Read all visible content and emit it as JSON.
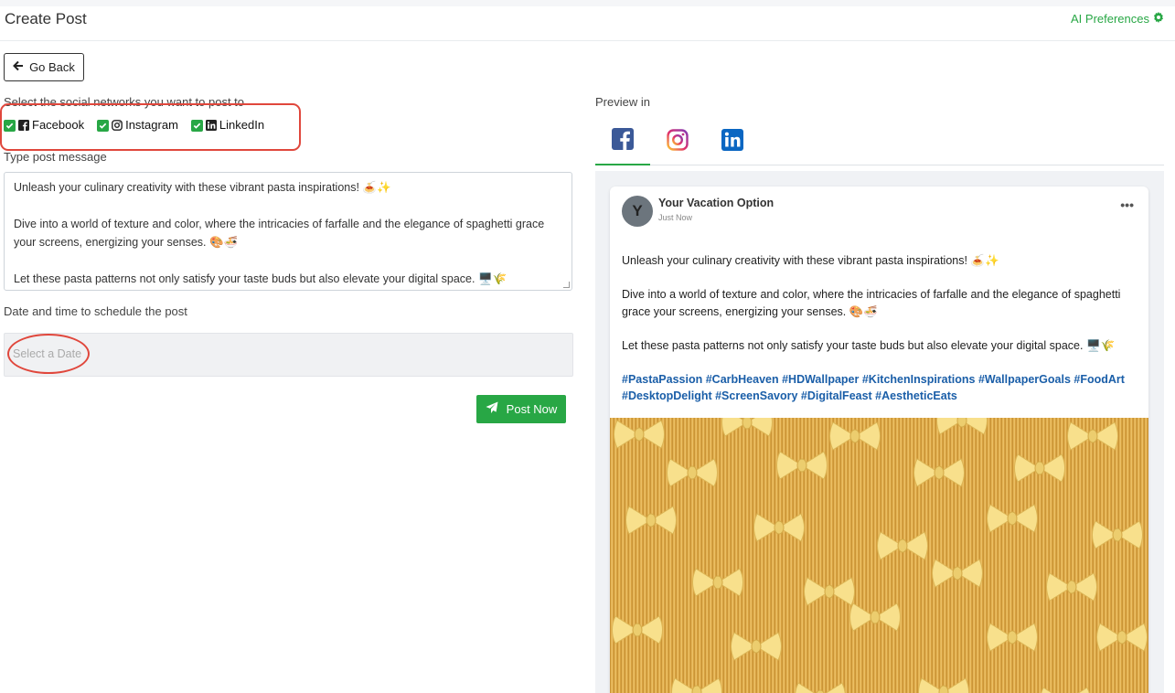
{
  "header": {
    "title": "Create Post",
    "ai_preferences": "AI Preferences"
  },
  "actions": {
    "go_back": "Go Back",
    "post_now": "Post Now"
  },
  "networks": {
    "label": "Select the social networks you want to post to",
    "items": [
      {
        "label": "Facebook",
        "checked": true,
        "icon": "facebook-square-icon"
      },
      {
        "label": "Instagram",
        "checked": true,
        "icon": "instagram-icon"
      },
      {
        "label": "LinkedIn",
        "checked": true,
        "icon": "linkedin-icon"
      }
    ]
  },
  "message": {
    "label": "Type post message",
    "lines": [
      "Unleash your culinary creativity with these vibrant pasta inspirations! 🍝✨",
      "Dive into a world of texture and color, where the intricacies of farfalle and the elegance of spaghetti grace your screens, energizing your senses. 🎨🍜",
      "Let these pasta patterns not only satisfy your taste buds but also elevate your digital space. 🖥️🌾"
    ]
  },
  "schedule": {
    "label": "Date and time to schedule the post",
    "placeholder": "Select a Date"
  },
  "preview": {
    "label": "Preview in",
    "tabs": [
      {
        "name": "facebook",
        "active": true
      },
      {
        "name": "instagram",
        "active": false
      },
      {
        "name": "linkedin",
        "active": false
      }
    ],
    "post": {
      "avatar_letter": "Y",
      "author": "Your Vacation Option",
      "time": "Just Now",
      "more": "•••",
      "paragraphs": [
        "Unleash your culinary creativity with these vibrant pasta inspirations! 🍝✨",
        "Dive into a world of texture and color, where the intricacies of farfalle and the elegance of spaghetti grace your screens, energizing your senses. 🎨🍜",
        "Let these pasta patterns not only satisfy your taste buds but also elevate your digital space. 🖥️🌾"
      ],
      "hashtags": "#PastaPassion #CarbHeaven #HDWallpaper #KitchenInspirations #WallpaperGoals #FoodArt #DesktopDelight #ScreenSavory #DigitalFeast #AestheticEats"
    }
  },
  "colors": {
    "accent": "#28a745",
    "annotation": "#e0473c",
    "facebook": "#3b5998",
    "linkedin": "#0a66c2",
    "hashtag": "#1a5ea8"
  }
}
